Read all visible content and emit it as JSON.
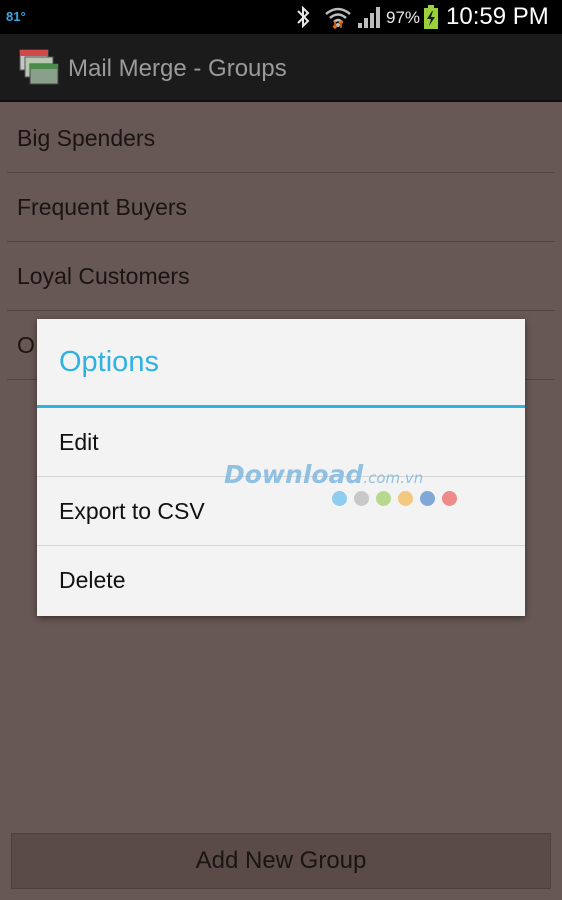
{
  "status_bar": {
    "temperature": "81°",
    "battery_percent": "97%",
    "time": "10:59 PM",
    "icons": [
      "bluetooth-icon",
      "wifi-icon",
      "signal-icon",
      "battery-charging-icon"
    ]
  },
  "action_bar": {
    "title": "Mail Merge - Groups",
    "icon": "mail-stack-icon"
  },
  "groups": [
    "Big Spenders",
    "Frequent Buyers",
    "Loyal Customers",
    "O"
  ],
  "dialog": {
    "title": "Options",
    "options": [
      "Edit",
      "Export to CSV",
      "Delete"
    ]
  },
  "add_button_label": "Add New Group",
  "watermark": {
    "main": "Download",
    "suffix": ".com.vn",
    "dot_colors": [
      "#8ecdf0",
      "#c8c8c8",
      "#b6d98e",
      "#f2c97e",
      "#7fa8d8",
      "#ee8a8a"
    ]
  },
  "colors": {
    "accent": "#2fb2e0",
    "background": "#675755",
    "actionbar": "#1b1b1b"
  }
}
